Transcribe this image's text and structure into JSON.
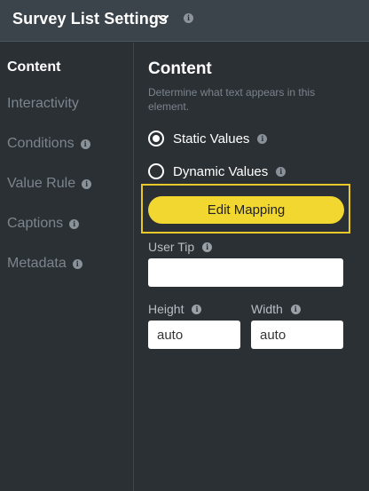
{
  "header": {
    "title": "Survey List Settings",
    "info_glyph": "i"
  },
  "sidebar": {
    "items": [
      {
        "label": "Content",
        "active": true,
        "has_info": false
      },
      {
        "label": "Interactivity",
        "active": false,
        "has_info": false
      },
      {
        "label": "Conditions",
        "active": false,
        "has_info": true
      },
      {
        "label": "Value Rule",
        "active": false,
        "has_info": true
      },
      {
        "label": "Captions",
        "active": false,
        "has_info": true
      },
      {
        "label": "Metadata",
        "active": false,
        "has_info": true
      }
    ]
  },
  "content": {
    "title": "Content",
    "description": "Determine what text appears in this element.",
    "options": [
      {
        "label": "Static Values",
        "checked": true
      },
      {
        "label": "Dynamic Values",
        "checked": false
      }
    ],
    "edit_mapping_label": "Edit Mapping",
    "user_tip": {
      "label": "User Tip",
      "value": ""
    },
    "height": {
      "label": "Height",
      "value": "auto"
    },
    "width": {
      "label": "Width",
      "value": "auto"
    }
  },
  "colors": {
    "background": "#2b3035",
    "header": "#3b444b",
    "accent_button": "#f2d730",
    "highlight_border": "#e8c929"
  },
  "icons": {
    "dropdown": "chevron-down-icon",
    "info": "info-icon"
  }
}
